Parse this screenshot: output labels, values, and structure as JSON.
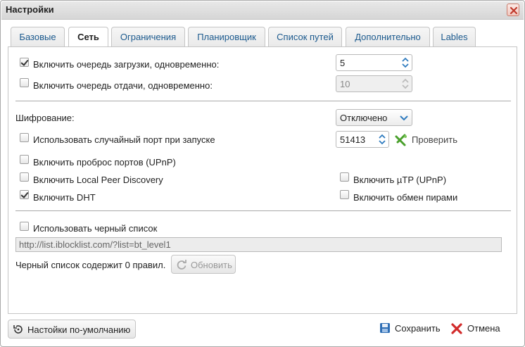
{
  "window": {
    "title": "Настройки"
  },
  "tabs": [
    {
      "label": "Базовые",
      "active": false
    },
    {
      "label": "Сеть",
      "active": true
    },
    {
      "label": "Ограничения",
      "active": false
    },
    {
      "label": "Планировщик",
      "active": false
    },
    {
      "label": "Список путей",
      "active": false
    },
    {
      "label": "Дополнительно",
      "active": false
    },
    {
      "label": "Lables",
      "active": false
    }
  ],
  "queue": {
    "download": {
      "label": "Включить очередь загрузки, одновременно:",
      "checked": true,
      "value": "5"
    },
    "upload": {
      "label": "Включить очередь отдачи, одновременно:",
      "checked": false,
      "value": "10"
    }
  },
  "encryption": {
    "label": "Шифрование:",
    "value": "Отключено"
  },
  "random_port": {
    "label": "Использовать случайный порт при запуске",
    "checked": false,
    "port": "51413",
    "check_label": "Проверить"
  },
  "upnp": {
    "label": "Включить проброс портов (UPnP)",
    "checked": false
  },
  "lpd": {
    "label": "Включить Local Peer Discovery",
    "checked": false
  },
  "utp": {
    "label": "Включить µTP (UPnP)",
    "checked": false
  },
  "dht": {
    "label": "Включить DHT",
    "checked": true
  },
  "pex": {
    "label": "Включить обмен пирами",
    "checked": false
  },
  "blocklist": {
    "label": "Использовать черный список",
    "checked": false,
    "url": "http://list.iblocklist.com/?list=bt_level1",
    "info": "Черный список содержит 0 правил.",
    "update_label": "Обновить"
  },
  "footer": {
    "defaults_label": "Настойки по-умолчанию",
    "save_label": "Сохранить",
    "cancel_label": "Отмена"
  },
  "colors": {
    "tab_text": "#1c5a8e",
    "check_icon": "#4aa02c",
    "cancel_icon": "#d22b2b",
    "save_icon": "#2f6fb5"
  }
}
